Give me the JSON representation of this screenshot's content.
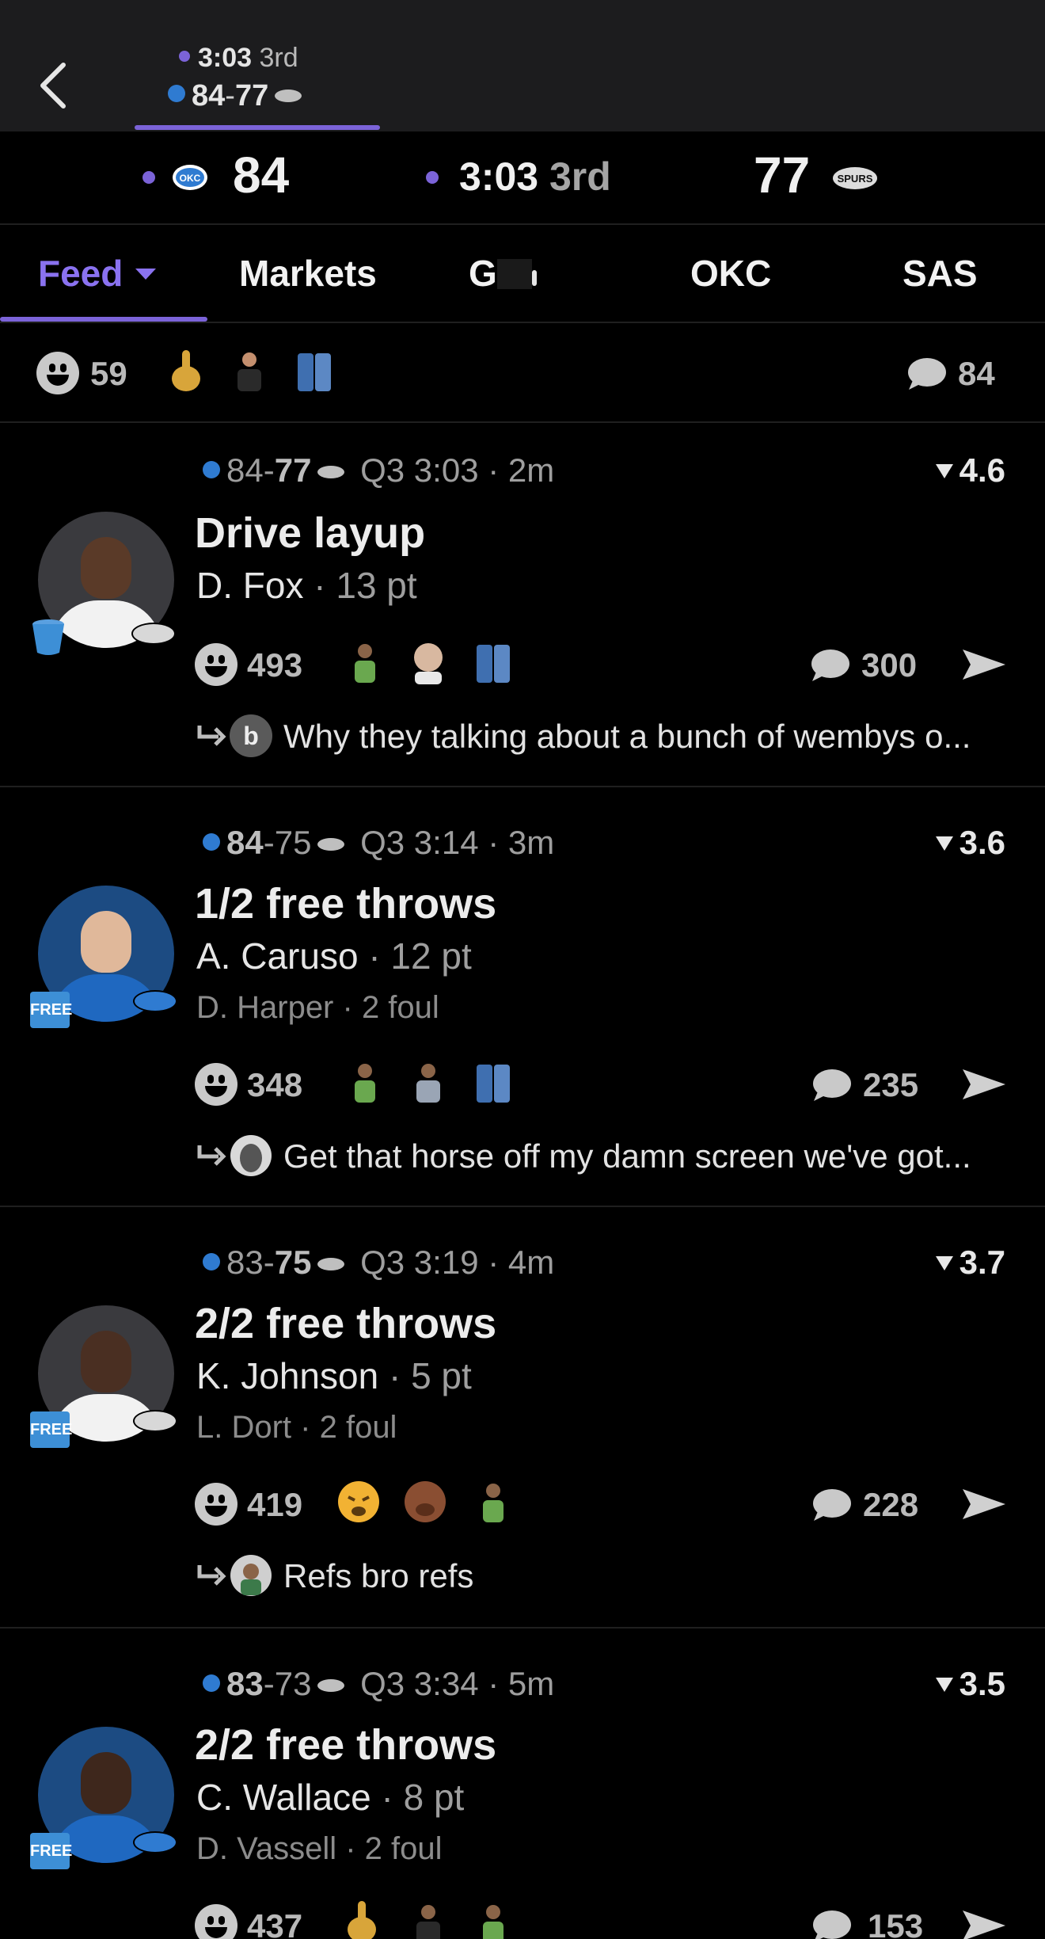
{
  "header": {
    "back_icon": "chevron-left-icon",
    "mini_score": {
      "clock": "3:03",
      "quarter": "3rd",
      "home_score": "84",
      "separator": "-",
      "away_score": "77"
    }
  },
  "scoreboard": {
    "home_score": "84",
    "clock": "3:03",
    "quarter": "3rd",
    "away_score": "77"
  },
  "tabs": [
    {
      "label": "Feed"
    },
    {
      "label": "Markets"
    },
    {
      "label": "G"
    },
    {
      "label": "OKC"
    },
    {
      "label": "SAS"
    }
  ],
  "reactions": {
    "smile_count": "59",
    "comment_count": "84"
  },
  "feed": [
    {
      "score_home": "84",
      "score_away": "77",
      "time": "Q3 3:03",
      "ago": "2m",
      "rating": "4.6",
      "play": "Drive layup",
      "player": "D. Fox",
      "player_stat": "13 pt",
      "foul_player": "",
      "foul_stat": "",
      "reactions": "493",
      "comments": "300",
      "reply_initial": "b",
      "reply": "Why they talking about a bunch of wembys o...",
      "badge": "bucket"
    },
    {
      "score_home": "84",
      "score_away": "75",
      "time": "Q3 3:14",
      "ago": "3m",
      "rating": "3.6",
      "play": "1/2 free throws",
      "player": "A. Caruso",
      "player_stat": "12 pt",
      "foul_player": "D. Harper",
      "foul_stat": "2 foul",
      "reactions": "348",
      "comments": "235",
      "reply_initial": "",
      "reply": "Get that horse off my damn screen we've got...",
      "badge": "FREE"
    },
    {
      "score_home": "83",
      "score_away": "75",
      "time": "Q3 3:19",
      "ago": "4m",
      "rating": "3.7",
      "play": "2/2 free throws",
      "player": "K. Johnson",
      "player_stat": "5 pt",
      "foul_player": "L. Dort",
      "foul_stat": "2 foul",
      "reactions": "419",
      "comments": "228",
      "reply_initial": "",
      "reply": "Refs bro refs",
      "badge": "FREE"
    },
    {
      "score_home": "83",
      "score_away": "73",
      "time": "Q3 3:34",
      "ago": "5m",
      "rating": "3.5",
      "play": "2/2 free throws",
      "player": "C. Wallace",
      "player_stat": "8 pt",
      "foul_player": "D. Vassell",
      "foul_stat": "2 foul",
      "reactions": "437",
      "comments": "153",
      "reply_initial": "",
      "reply": "",
      "badge": "FREE"
    }
  ],
  "colors": {
    "accent": "#7b63d8",
    "background": "#000000",
    "topbar": "#1c1c1e"
  }
}
